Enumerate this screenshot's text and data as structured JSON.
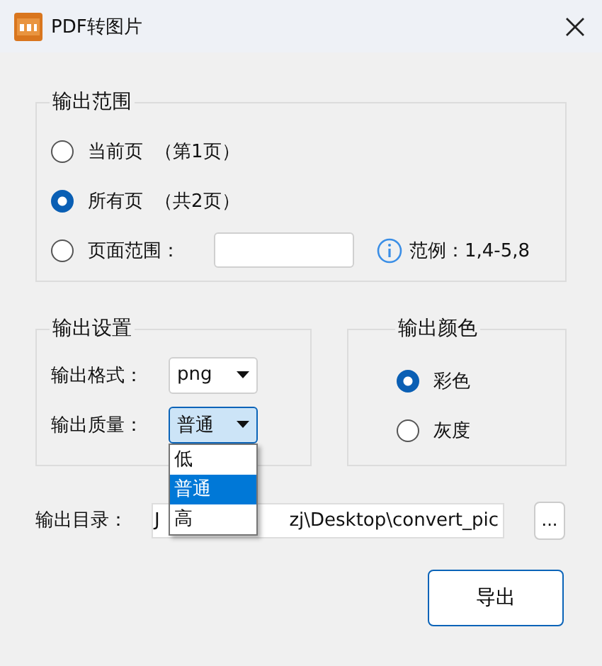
{
  "window": {
    "title": "PDF转图片"
  },
  "range_group": {
    "title": "输出范围",
    "options": [
      {
        "kind": "page",
        "label": "当前页",
        "note": "（第1页）",
        "selected": false
      },
      {
        "kind": "page",
        "label": "所有页",
        "note": "（共2页）",
        "selected": true
      },
      {
        "kind": "range",
        "label": "页面范围：",
        "selected": false
      }
    ],
    "range_hint": "范例：1,4-5,8"
  },
  "settings_group": {
    "title": "输出设置",
    "fields": [
      {
        "label": "输出格式：",
        "value": "png",
        "open": false
      },
      {
        "label": "输出质量：",
        "value": "普通",
        "open": true,
        "options": [
          {
            "label": "低",
            "selected": false
          },
          {
            "label": "普通",
            "selected": true
          },
          {
            "label": "高",
            "selected": false
          }
        ]
      }
    ]
  },
  "color_group": {
    "title": "输出颜色",
    "options": [
      {
        "label": "彩色",
        "selected": true
      },
      {
        "label": "灰度",
        "selected": false
      }
    ]
  },
  "output_dir": {
    "label": "输出目录：",
    "value_parts": [
      "J",
      "zj\\Desktop\\convert_pic"
    ],
    "browse": "..."
  },
  "export_button": "导出"
}
